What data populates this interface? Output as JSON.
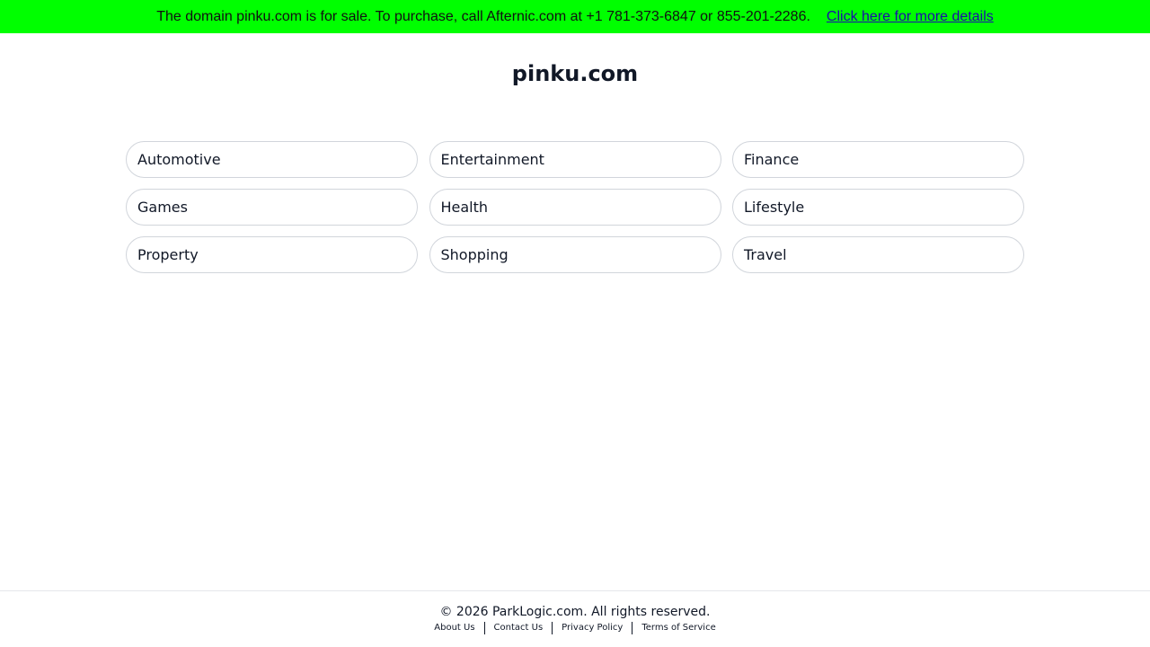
{
  "banner": {
    "text": "The domain pinku.com is for sale. To purchase, call Afternic.com at +1 781-373-6847 or 855-201-2286.",
    "link_label": "Click here for more details",
    "background": "#00ff00",
    "link_color": "#1a0dab"
  },
  "site": {
    "title": "pinku.com"
  },
  "categories": [
    "Automotive",
    "Entertainment",
    "Finance",
    "Games",
    "Health",
    "Lifestyle",
    "Property",
    "Shopping",
    "Travel"
  ],
  "footer": {
    "copyright": "© 2026 ParkLogic.com. All rights reserved.",
    "links": [
      "About Us",
      "Contact Us",
      "Privacy Policy",
      "Terms of Service"
    ]
  }
}
